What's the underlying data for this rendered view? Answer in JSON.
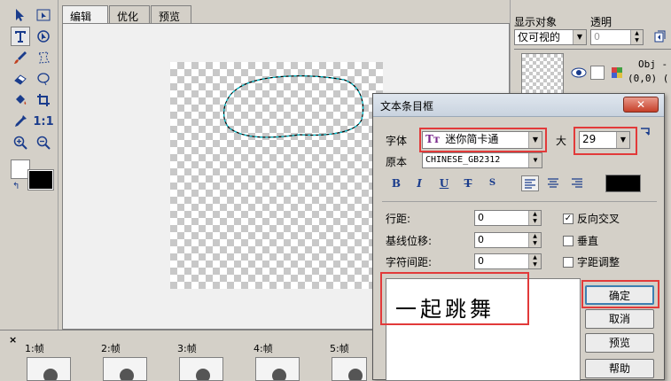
{
  "editor": {
    "tabs": [
      {
        "label": "编辑"
      },
      {
        "label": "优化"
      },
      {
        "label": "预览"
      }
    ]
  },
  "toolbox": {
    "tools": [
      "select-arrow",
      "subselect",
      "text",
      "transform",
      "brush",
      "lasso",
      "eraser",
      "oval-select",
      "fill",
      "crop",
      "eyedropper",
      "actual-size",
      "zoom-in",
      "zoom-out"
    ]
  },
  "right_panel": {
    "display_label": "显示对象",
    "display_value": "仅可视的",
    "opacity_label": "透明",
    "opacity_value": "0",
    "obj_name": "Obj -",
    "obj_coords": "(0,0) ("
  },
  "timeline": {
    "frames": [
      {
        "label": "1:帧"
      },
      {
        "label": "2:帧"
      },
      {
        "label": "3:帧"
      },
      {
        "label": "4:帧"
      },
      {
        "label": "5:帧"
      }
    ],
    "close_glyph": "×"
  },
  "dialog": {
    "title": "文本条目框",
    "close_glyph": "✕",
    "font_label": "字体",
    "font_value": "迷你简卡通",
    "size_label": "大",
    "size_value": "29",
    "source_label": "原本",
    "source_value": "CHINESE_GB2312",
    "format_buttons": [
      "B",
      "I",
      "U",
      "T",
      "S"
    ],
    "line_spacing_label": "行距:",
    "line_spacing_value": "0",
    "baseline_label": "基线位移:",
    "baseline_value": "0",
    "char_spacing_label": "字符间距:",
    "char_spacing_value": "0",
    "check_reverse_label": "反向交叉",
    "check_reverse_checked": "✓",
    "check_vertical_label": "垂直",
    "check_kerning_label": "字距调整",
    "text_content": "一起跳舞",
    "ok_label": "确定",
    "cancel_label": "取消",
    "preview_label": "预览",
    "help_label": "帮助",
    "text_color": "#000000",
    "highlight_color": "#e23a3a"
  }
}
